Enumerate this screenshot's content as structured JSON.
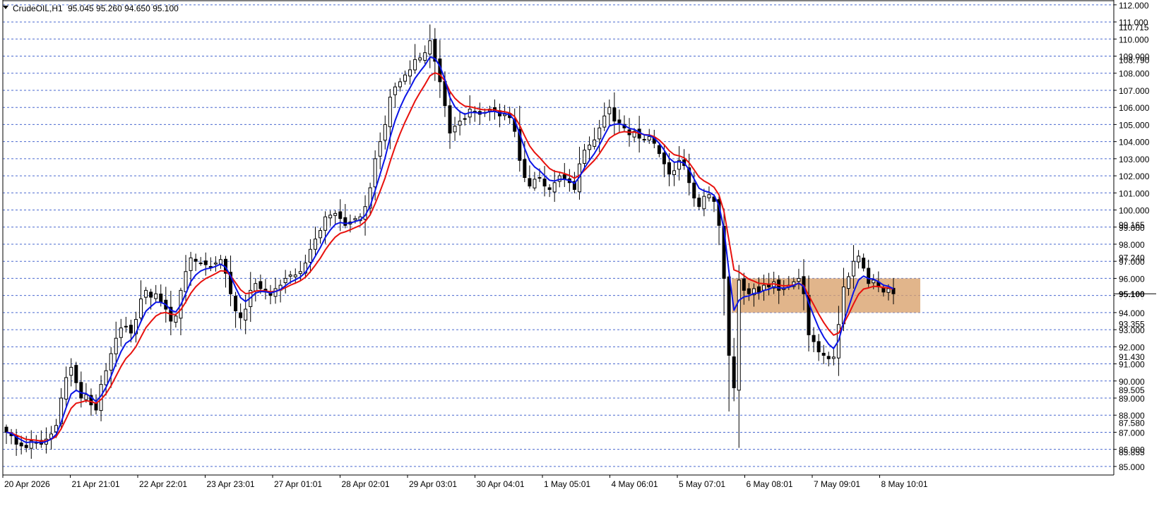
{
  "header": {
    "symbol": "CrudeOIL,H1",
    "ohlc": "95.045 95.260 94.650 95.100"
  },
  "colors": {
    "background": "#ffffff",
    "grid": "#2b4fc7",
    "candle": "#000000",
    "fast_ma": "#0a14e6",
    "slow_ma": "#e8110d",
    "zone": "#d8a06a",
    "axis": "#000000"
  },
  "chart_data": {
    "type": "candlestick",
    "ylim": [
      84.5,
      112.2
    ],
    "grid": true,
    "y_ticks": [
      85,
      86,
      87,
      88,
      89,
      90,
      91,
      92,
      93,
      94,
      95,
      96,
      97,
      98,
      99,
      100,
      101,
      102,
      103,
      104,
      105,
      106,
      107,
      108,
      109,
      110,
      111,
      112
    ],
    "y_tick_labels": [
      "85.000",
      "86.000",
      "87.000",
      "88.000",
      "89.000",
      "90.000",
      "91.000",
      "92.000",
      "93.000",
      "94.000",
      "95.000",
      "96.000",
      "97.000",
      "98.000",
      "99.000",
      "100.000",
      "101.000",
      "102.000",
      "103.000",
      "104.000",
      "105.000",
      "106.000",
      "107.000",
      "108.000",
      "109.000",
      "110.000",
      "111.000",
      "112.000"
    ],
    "extra_price_labels": [
      {
        "text": "85.855",
        "value": 85.855
      },
      {
        "text": "87.580",
        "value": 87.58
      },
      {
        "text": "89.505",
        "value": 89.505
      },
      {
        "text": "91.430",
        "value": 91.43
      },
      {
        "text": "93.355",
        "value": 93.355
      },
      {
        "text": "97.240",
        "value": 97.24
      },
      {
        "text": "99.165",
        "value": 99.165
      },
      {
        "text": "108.790",
        "value": 108.79
      },
      {
        "text": "110.715",
        "value": 110.715
      }
    ],
    "current_price": {
      "text": "95.100",
      "value": 95.1
    },
    "x_labels": [
      "20 Apr 2026",
      "21 Apr 21:01",
      "22 Apr 22:01",
      "23 Apr 23:01",
      "27 Apr 01:01",
      "28 Apr 02:01",
      "29 Apr 03:01",
      "30 Apr 04:01",
      "1 May 05:01",
      "4 May 06:01",
      "5 May 07:01",
      "6 May 08:01",
      "7 May 09:01",
      "8 May 10:01"
    ],
    "series": [
      {
        "kind": "close",
        "values": [
          87.0,
          86.8,
          86.3,
          86.2,
          86.1,
          86.5,
          86.4,
          86.3,
          86.6,
          86.9,
          87.4,
          89.0,
          90.2,
          90.8,
          89.9,
          89.0,
          89.2,
          88.6,
          88.3,
          89.8,
          90.6,
          91.6,
          92.5,
          93.1,
          93.2,
          92.8,
          93.6,
          94.8,
          95.3,
          94.9,
          95.1,
          94.6,
          94.2,
          93.5,
          93.8,
          95.3,
          96.4,
          97.2,
          97.0,
          96.9,
          96.8,
          96.7,
          96.9,
          97.1,
          96.3,
          95.1,
          94.1,
          93.7,
          94.2,
          95.3,
          95.7,
          95.4,
          95.2,
          95.0,
          95.4,
          95.6,
          96.0,
          96.2,
          96.2,
          96.4,
          96.9,
          97.7,
          98.3,
          98.8,
          99.6,
          99.7,
          99.8,
          99.5,
          99.1,
          99.3,
          99.5,
          99.6,
          100.2,
          101.3,
          103.0,
          104.0,
          105.0,
          106.6,
          107.2,
          107.5,
          107.9,
          108.2,
          108.8,
          108.9,
          109.2,
          109.9,
          108.7,
          107.5,
          106.1,
          104.5,
          104.9,
          105.2,
          105.3,
          105.9,
          105.7,
          105.6,
          105.7,
          105.9,
          105.8,
          105.5,
          105.6,
          105.4,
          104.6,
          102.9,
          101.9,
          101.4,
          101.8,
          101.9,
          101.4,
          101.2,
          101.6,
          102.0,
          101.8,
          101.6,
          101.2,
          102.7,
          103.5,
          103.8,
          104.1,
          104.8,
          105.5,
          106.0,
          105.2,
          105.1,
          104.8,
          104.4,
          104.6,
          104.2,
          104.1,
          104.3,
          103.9,
          103.3,
          102.7,
          102.1,
          102.3,
          102.9,
          102.6,
          101.6,
          100.7,
          100.2,
          100.8,
          100.9,
          100.5,
          99.1,
          96.0,
          91.5,
          89.6,
          95.9,
          95.3,
          95.1,
          95.4,
          95.2,
          95.6,
          95.5,
          95.8,
          95.3,
          95.4,
          95.6,
          95.8,
          96.0,
          95.1,
          92.7,
          92.3,
          91.7,
          91.5,
          91.3,
          91.4,
          93.3,
          95.5,
          96.1,
          97.0,
          97.3,
          96.6,
          95.7,
          95.9,
          95.5,
          95.2,
          95.4,
          95.1
        ],
        "name": ""
      }
    ]
  }
}
